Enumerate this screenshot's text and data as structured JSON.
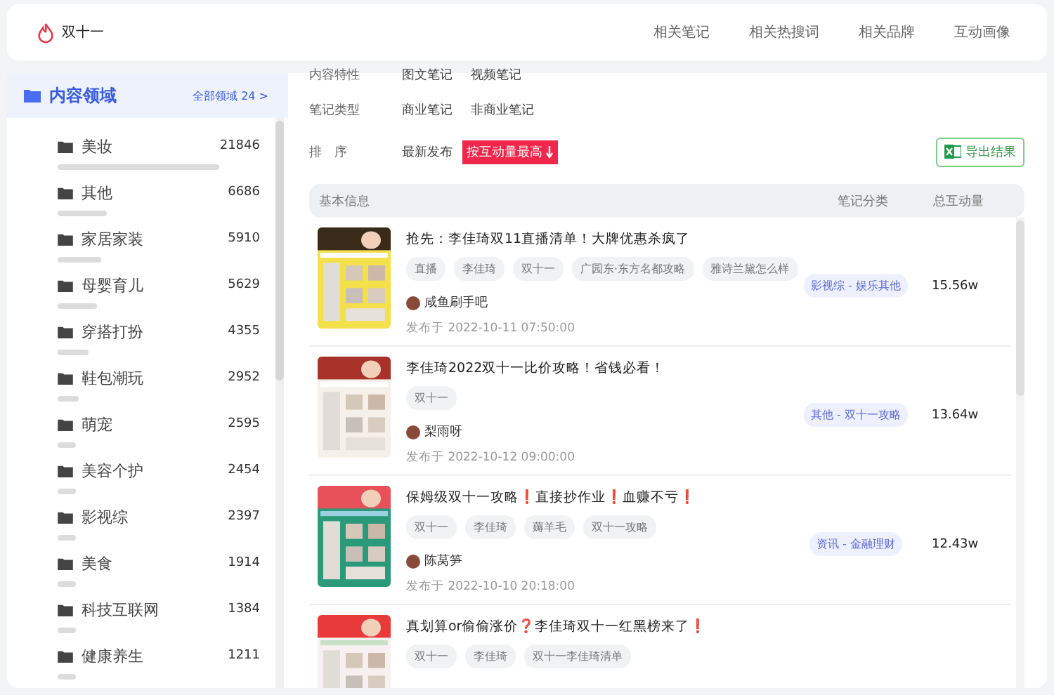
{
  "header": {
    "title": "双十一",
    "nav": [
      {
        "label": "相关笔记"
      },
      {
        "label": "相关热搜词"
      },
      {
        "label": "相关品牌"
      },
      {
        "label": "互动画像"
      }
    ]
  },
  "sidebar": {
    "title": "内容领域",
    "all_link": "全部领域 24 >",
    "items": [
      {
        "label": "美妆",
        "count": "21846",
        "level": 0.82
      },
      {
        "label": "其他",
        "count": "6686",
        "level": 0.25
      },
      {
        "label": "家居家装",
        "count": "5910",
        "level": 0.22
      },
      {
        "label": "母婴育儿",
        "count": "5629",
        "level": 0.2
      },
      {
        "label": "穿搭打扮",
        "count": "4355",
        "level": 0.16
      },
      {
        "label": "鞋包潮玩",
        "count": "2952",
        "level": 0.11
      },
      {
        "label": "萌宠",
        "count": "2595",
        "level": 0.09
      },
      {
        "label": "美容个护",
        "count": "2454",
        "level": 0.09
      },
      {
        "label": "影视综",
        "count": "2397",
        "level": 0.09
      },
      {
        "label": "美食",
        "count": "1914",
        "level": 0.09
      },
      {
        "label": "科技互联网",
        "count": "1384",
        "level": 0.09
      },
      {
        "label": "健康养生",
        "count": "1211",
        "level": 0.09
      }
    ]
  },
  "filters": [
    {
      "label": "内容特性",
      "options": [
        "图文笔记",
        "视频笔记"
      ]
    },
    {
      "label": "笔记类型",
      "options": [
        "商业笔记",
        "非商业笔记"
      ]
    }
  ],
  "sort": {
    "label": "排　序",
    "options": [
      {
        "label": "最新发布",
        "selected": false
      },
      {
        "label": "按互动量最高",
        "selected": true
      }
    ]
  },
  "export_button": "导出结果",
  "table": {
    "columns": [
      "基本信息",
      "笔记分类",
      "总互动量"
    ],
    "rows": [
      {
        "title": "抢先：李佳琦双11直播清单！大牌优惠杀疯了",
        "tags": [
          "直播",
          "李佳琦",
          "双十一",
          "广园东·东方名都攻略",
          "雅诗兰黛怎么样"
        ],
        "author": "咸鱼刷手吧",
        "published": "发布于 2022-10-11 07:50:00",
        "category": "影视综 - 娱乐其他",
        "total": "15.56w"
      },
      {
        "title": "李佳琦2022双十一比价攻略！省钱必看！",
        "tags": [
          "双十一"
        ],
        "author": "梨雨呀",
        "published": "发布于 2022-10-12 09:00:00",
        "category": "其他 - 双十一攻略",
        "total": "13.64w"
      },
      {
        "title": "保姆级双十一攻略❗直接抄作业❗血赚不亏❗",
        "tags": [
          "双十一",
          "李佳琦",
          "薅羊毛",
          "双十一攻略"
        ],
        "author": "陈莴笋",
        "published": "发布于 2022-10-10 20:18:00",
        "category": "资讯 - 金融理财",
        "total": "12.43w"
      },
      {
        "title": "真划算or偷偷涨价❓李佳琦双十一红黑榜来了❗",
        "tags": [
          "双十一",
          "李佳琦",
          "双十一李佳琦清单"
        ]
      }
    ]
  }
}
